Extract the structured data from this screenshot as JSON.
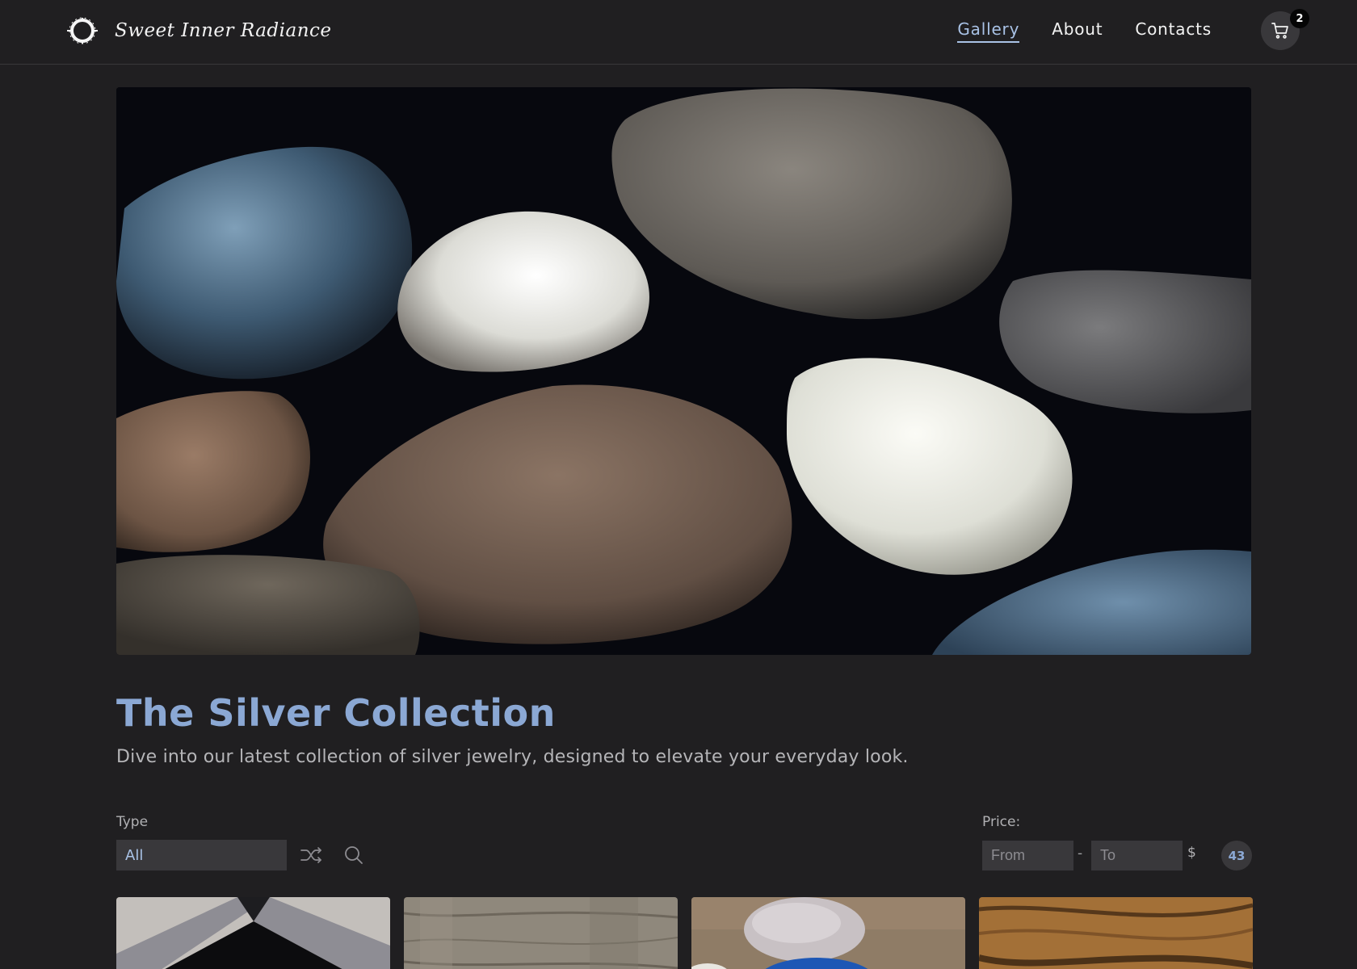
{
  "brand": {
    "name": "Sweet Inner Radiance",
    "logo_icon": "sun-ring-icon"
  },
  "nav": {
    "items": [
      {
        "label": "Gallery",
        "active": true
      },
      {
        "label": "About",
        "active": false
      },
      {
        "label": "Contacts",
        "active": false
      }
    ]
  },
  "cart": {
    "icon": "shopping-cart-icon",
    "count": "2"
  },
  "hero": {
    "image": "pebbles-and-shells-photo"
  },
  "collection": {
    "title": "The Silver Collection",
    "subtitle": "Dive into our latest collection of silver jewelry, designed to elevate your everyday look."
  },
  "filters": {
    "type_label": "Type",
    "type_value": "All",
    "shuffle_icon": "shuffle-icon",
    "search_icon": "search-icon",
    "price_label": "Price:",
    "price_from_placeholder": "From",
    "price_to_placeholder": "To",
    "price_separator": "-",
    "currency": "$",
    "result_count": "43"
  },
  "products": [
    {
      "image": "silver-box-photo"
    },
    {
      "image": "driftwood-photo"
    },
    {
      "image": "stones-photo"
    },
    {
      "image": "wood-grain-photo"
    }
  ],
  "colors": {
    "background": "#201f21",
    "accent": "#8ba8d4",
    "nav_active": "#a9c2e6",
    "control_bg": "#39383b"
  }
}
